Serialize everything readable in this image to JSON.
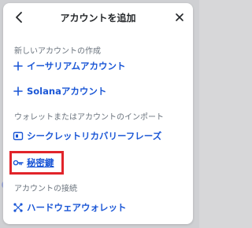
{
  "modal": {
    "title": "アカウントを追加",
    "back_icon": "chevron-left-icon",
    "close_icon": "close-icon"
  },
  "sections": {
    "create_label": "新しいアカウントの作成",
    "import_label": "ウォレットまたはアカウントのインポート",
    "connect_label": "アカウントの接続"
  },
  "actions": {
    "ethereum": {
      "label": "イーサリアムアカウント",
      "icon": "plus-icon"
    },
    "solana": {
      "label": "Solanaアカウント",
      "icon": "plus-icon"
    },
    "srp": {
      "label": "シークレットリカバリーフレーズ",
      "icon": "document-icon"
    },
    "private_key": {
      "label": "秘密鍵",
      "icon": "key-icon"
    },
    "hardware": {
      "label": "ハードウェアウォレット",
      "icon": "hardware-icon"
    }
  },
  "colors": {
    "accent": "#1b57d6",
    "highlight": "#e1242a",
    "text": "#24272a",
    "muted": "#6a737d"
  }
}
